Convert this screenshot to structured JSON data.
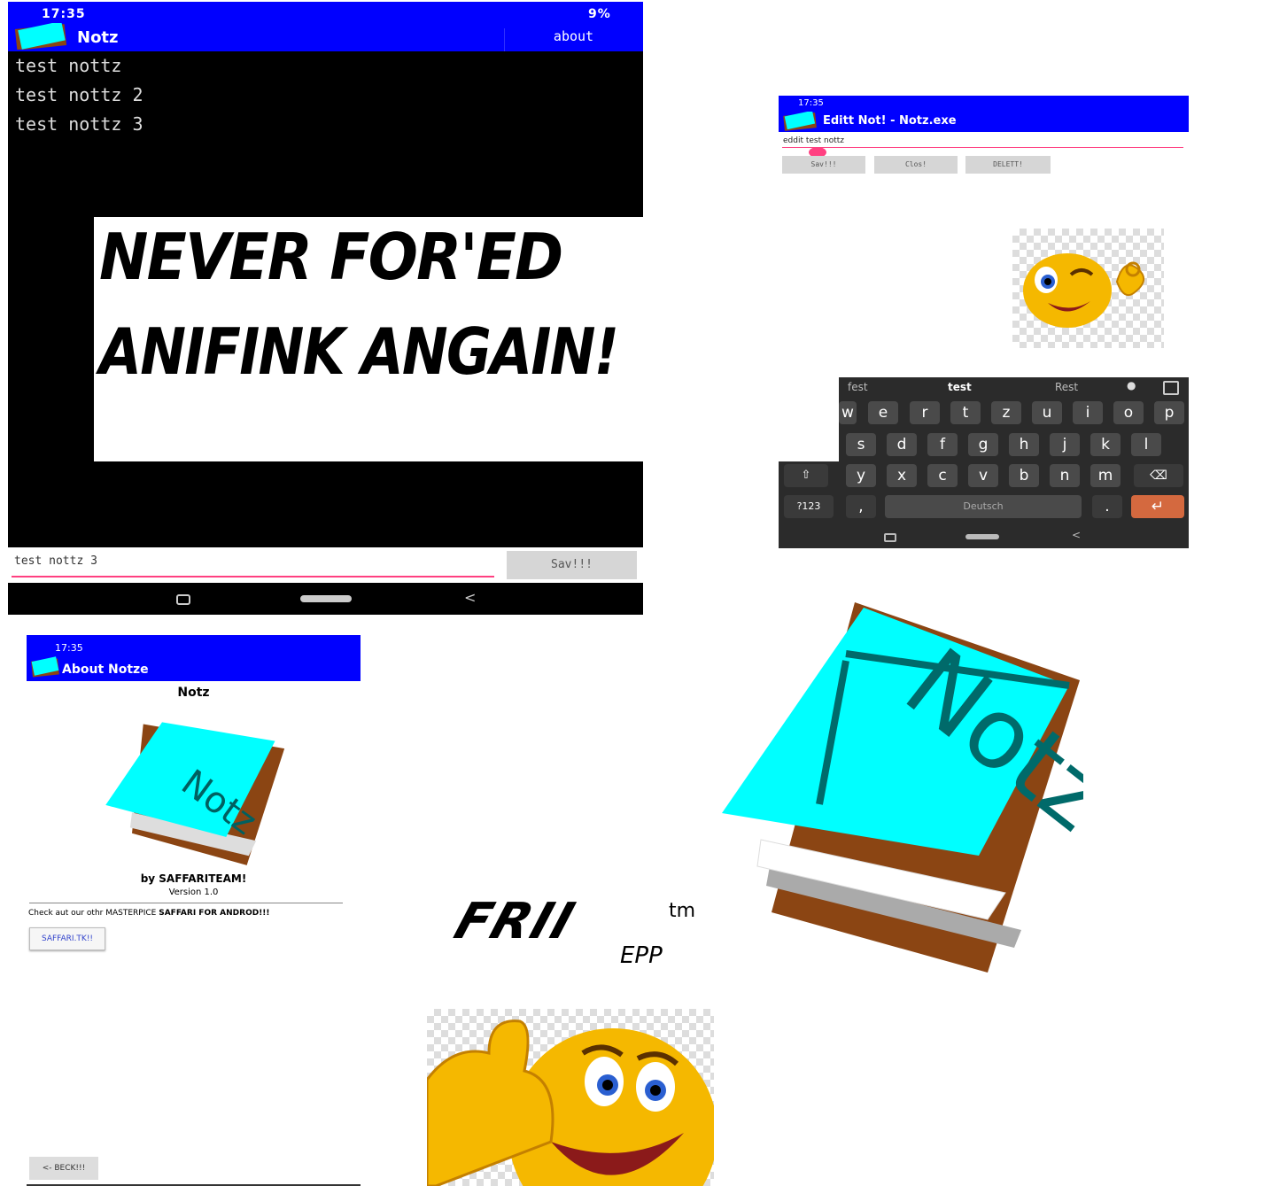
{
  "main_screen": {
    "status_time": "17:35",
    "status_right": "9%",
    "app_title": "Notz",
    "about_label": "about",
    "notes": [
      "test nottz",
      "test nottz 2",
      "test nottz 3"
    ],
    "input_value": "test nottz 3",
    "save_label": "Sav!!!"
  },
  "banner": {
    "line1": "NEVER FOR'ED",
    "line2": "ANIFINK ANGAIN!"
  },
  "edit_screen": {
    "status_time": "17:35",
    "title": "Editt Not! - Notz.exe",
    "input_value": "eddit test nottz",
    "save_label": "Sav!!!",
    "close_label": "Clos!",
    "delete_label": "DELETT!"
  },
  "keyboard": {
    "suggestions": [
      "fest",
      "test",
      "Rest"
    ],
    "row1": [
      "w",
      "e",
      "r",
      "t",
      "z",
      "u",
      "i",
      "o",
      "p"
    ],
    "row2": [
      "s",
      "d",
      "f",
      "g",
      "h",
      "j",
      "k",
      "l"
    ],
    "row3": [
      "y",
      "x",
      "c",
      "v",
      "b",
      "n",
      "m"
    ],
    "symbols_label": "?123",
    "comma_label": ",",
    "space_label": "Deutsch",
    "period_label": "."
  },
  "about_screen": {
    "status_time": "17:35",
    "title": "About Notze",
    "app_name": "Notz",
    "by_line": "by SAFFARITEAM!",
    "version": "Version 1.0",
    "promo_prefix": "Check aut our othr MASTERPICE ",
    "promo_bold": "SAFFARI FOR ANDROD!!!",
    "link_button": "SAFFARI.TK!!",
    "back_button": "<- BECK!!!"
  },
  "logo_text": "Notz",
  "frii": {
    "main": "FRII",
    "tm": "tm",
    "sub": "EPP"
  },
  "colors": {
    "app_bar": "#0000ff",
    "note_cyan": "#00ffff",
    "clipboard_brown": "#8b4513",
    "accent_pink": "#ff4081",
    "enter_key": "#d4693f"
  }
}
